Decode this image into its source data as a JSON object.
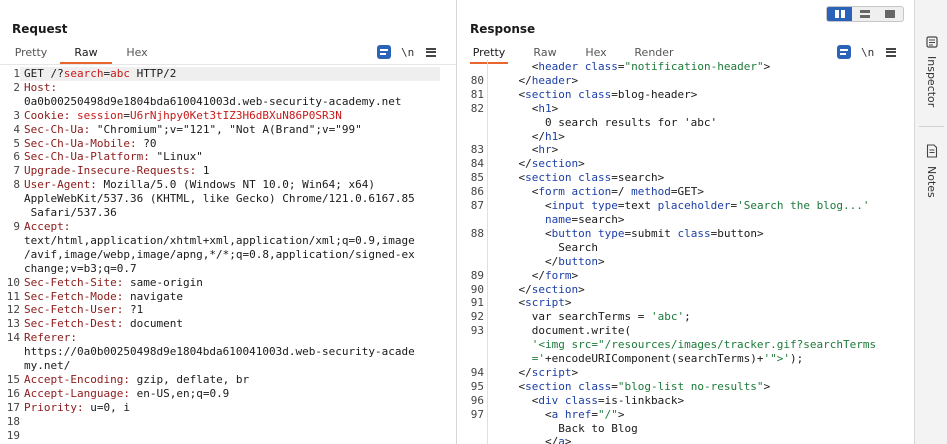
{
  "request": {
    "title": "Request",
    "tabs": [
      "Pretty",
      "Raw",
      "Hex"
    ],
    "active_tab": "Raw",
    "newline_icon_label": "\\n",
    "lines": [
      {
        "n": "1",
        "parts": [
          [
            "c-plain",
            "GET /?"
          ],
          [
            "c-red",
            "search"
          ],
          [
            "c-plain",
            "="
          ],
          [
            "c-red",
            "abc"
          ],
          [
            "c-plain",
            " HTTP/2"
          ]
        ]
      },
      {
        "n": "2",
        "parts": [
          [
            "c-hdr",
            "Host:"
          ]
        ]
      },
      {
        "n": "",
        "parts": [
          [
            "c-plain",
            "0a0b00250498d9e1804bda610041003d.web-security-academy.net"
          ]
        ]
      },
      {
        "n": "3",
        "parts": [
          [
            "c-hdr",
            "Cookie: "
          ],
          [
            "c-red",
            "session"
          ],
          [
            "c-plain",
            "="
          ],
          [
            "c-red",
            "U6rNjhpy0Ket3tIZ3H6dBXuN86P0SR3N"
          ]
        ]
      },
      {
        "n": "4",
        "parts": [
          [
            "c-hdr",
            "Sec-Ch-Ua: "
          ],
          [
            "c-plain",
            "\"Chromium\";v=\"121\", \"Not A(Brand\";v=\"99\""
          ]
        ]
      },
      {
        "n": "5",
        "parts": [
          [
            "c-hdr",
            "Sec-Ch-Ua-Mobile: "
          ],
          [
            "c-plain",
            "?0"
          ]
        ]
      },
      {
        "n": "6",
        "parts": [
          [
            "c-hdr",
            "Sec-Ch-Ua-Platform: "
          ],
          [
            "c-plain",
            "\"Linux\""
          ]
        ]
      },
      {
        "n": "7",
        "parts": [
          [
            "c-hdr",
            "Upgrade-Insecure-Requests: "
          ],
          [
            "c-plain",
            "1"
          ]
        ]
      },
      {
        "n": "8",
        "parts": [
          [
            "c-hdr",
            "User-Agent: "
          ],
          [
            "c-plain",
            "Mozilla/5.0 (Windows NT 10.0; Win64; x64)"
          ]
        ]
      },
      {
        "n": "",
        "parts": [
          [
            "c-plain",
            "AppleWebKit/537.36 (KHTML, like Gecko) Chrome/121.0.6167.85"
          ]
        ]
      },
      {
        "n": "",
        "parts": [
          [
            "c-plain",
            " Safari/537.36"
          ]
        ]
      },
      {
        "n": "9",
        "parts": [
          [
            "c-hdr",
            "Accept:"
          ]
        ]
      },
      {
        "n": "",
        "parts": [
          [
            "c-plain",
            "text/html,application/xhtml+xml,application/xml;q=0.9,image"
          ]
        ]
      },
      {
        "n": "",
        "parts": [
          [
            "c-plain",
            "/avif,image/webp,image/apng,*/*;q=0.8,application/signed-ex"
          ]
        ]
      },
      {
        "n": "",
        "parts": [
          [
            "c-plain",
            "change;v=b3;q=0.7"
          ]
        ]
      },
      {
        "n": "10",
        "parts": [
          [
            "c-hdr",
            "Sec-Fetch-Site: "
          ],
          [
            "c-plain",
            "same-origin"
          ]
        ]
      },
      {
        "n": "11",
        "parts": [
          [
            "c-hdr",
            "Sec-Fetch-Mode: "
          ],
          [
            "c-plain",
            "navigate"
          ]
        ]
      },
      {
        "n": "12",
        "parts": [
          [
            "c-hdr",
            "Sec-Fetch-User: "
          ],
          [
            "c-plain",
            "?1"
          ]
        ]
      },
      {
        "n": "13",
        "parts": [
          [
            "c-hdr",
            "Sec-Fetch-Dest: "
          ],
          [
            "c-plain",
            "document"
          ]
        ]
      },
      {
        "n": "14",
        "parts": [
          [
            "c-hdr",
            "Referer:"
          ]
        ]
      },
      {
        "n": "",
        "parts": [
          [
            "c-plain",
            "https://0a0b00250498d9e1804bda610041003d.web-security-acade"
          ]
        ]
      },
      {
        "n": "",
        "parts": [
          [
            "c-plain",
            "my.net/"
          ]
        ]
      },
      {
        "n": "15",
        "parts": [
          [
            "c-hdr",
            "Accept-Encoding: "
          ],
          [
            "c-plain",
            "gzip, deflate, br"
          ]
        ]
      },
      {
        "n": "16",
        "parts": [
          [
            "c-hdr",
            "Accept-Language: "
          ],
          [
            "c-plain",
            "en-US,en;q=0.9"
          ]
        ]
      },
      {
        "n": "17",
        "parts": [
          [
            "c-hdr",
            "Priority: "
          ],
          [
            "c-plain",
            "u=0, i"
          ]
        ]
      },
      {
        "n": "18",
        "parts": []
      },
      {
        "n": "19",
        "parts": []
      }
    ]
  },
  "response": {
    "title": "Response",
    "tabs": [
      "Pretty",
      "Raw",
      "Hex",
      "Render"
    ],
    "active_tab": "Pretty",
    "newline_icon_label": "\\n",
    "lines": [
      {
        "n": "",
        "parts": [
          [
            "c-plain",
            "      <"
          ],
          [
            "c-tag",
            "header"
          ],
          [
            "c-plain",
            " "
          ],
          [
            "c-attr",
            "class"
          ],
          [
            "c-plain",
            "="
          ],
          [
            "c-str",
            "\"notification-header\""
          ],
          [
            "c-plain",
            ">"
          ]
        ]
      },
      {
        "n": "80",
        "parts": [
          [
            "c-plain",
            "    </"
          ],
          [
            "c-tag",
            "header"
          ],
          [
            "c-plain",
            ">"
          ]
        ]
      },
      {
        "n": "81",
        "parts": [
          [
            "c-plain",
            "    <"
          ],
          [
            "c-tag",
            "section"
          ],
          [
            "c-plain",
            " "
          ],
          [
            "c-attr",
            "class"
          ],
          [
            "c-plain",
            "=blog-header>"
          ]
        ]
      },
      {
        "n": "82",
        "parts": [
          [
            "c-plain",
            "      <"
          ],
          [
            "c-tag",
            "h1"
          ],
          [
            "c-plain",
            ">"
          ]
        ]
      },
      {
        "n": "",
        "parts": [
          [
            "c-plain",
            "        0 search results for 'abc'"
          ]
        ]
      },
      {
        "n": "",
        "parts": [
          [
            "c-plain",
            "      </"
          ],
          [
            "c-tag",
            "h1"
          ],
          [
            "c-plain",
            ">"
          ]
        ]
      },
      {
        "n": "83",
        "parts": [
          [
            "c-plain",
            "      <"
          ],
          [
            "c-tag",
            "hr"
          ],
          [
            "c-plain",
            ">"
          ]
        ]
      },
      {
        "n": "84",
        "parts": [
          [
            "c-plain",
            "    </"
          ],
          [
            "c-tag",
            "section"
          ],
          [
            "c-plain",
            ">"
          ]
        ]
      },
      {
        "n": "85",
        "parts": [
          [
            "c-plain",
            "    <"
          ],
          [
            "c-tag",
            "section"
          ],
          [
            "c-plain",
            " "
          ],
          [
            "c-attr",
            "class"
          ],
          [
            "c-plain",
            "=search>"
          ]
        ]
      },
      {
        "n": "86",
        "parts": [
          [
            "c-plain",
            "      <"
          ],
          [
            "c-tag",
            "form"
          ],
          [
            "c-plain",
            " "
          ],
          [
            "c-attr",
            "action"
          ],
          [
            "c-plain",
            "=/ "
          ],
          [
            "c-attr",
            "method"
          ],
          [
            "c-plain",
            "=GET>"
          ]
        ]
      },
      {
        "n": "87",
        "parts": [
          [
            "c-plain",
            "        <"
          ],
          [
            "c-tag",
            "input"
          ],
          [
            "c-plain",
            " "
          ],
          [
            "c-attr",
            "type"
          ],
          [
            "c-plain",
            "=text "
          ],
          [
            "c-attr",
            "placeholder"
          ],
          [
            "c-plain",
            "="
          ],
          [
            "c-str",
            "'Search the blog...'"
          ]
        ]
      },
      {
        "n": "",
        "parts": [
          [
            "c-plain",
            "        "
          ],
          [
            "c-attr",
            "name"
          ],
          [
            "c-plain",
            "=search>"
          ]
        ]
      },
      {
        "n": "88",
        "parts": [
          [
            "c-plain",
            "        <"
          ],
          [
            "c-tag",
            "button"
          ],
          [
            "c-plain",
            " "
          ],
          [
            "c-attr",
            "type"
          ],
          [
            "c-plain",
            "=submit "
          ],
          [
            "c-attr",
            "class"
          ],
          [
            "c-plain",
            "=button>"
          ]
        ]
      },
      {
        "n": "",
        "parts": [
          [
            "c-plain",
            "          Search"
          ]
        ]
      },
      {
        "n": "",
        "parts": [
          [
            "c-plain",
            "        </"
          ],
          [
            "c-tag",
            "button"
          ],
          [
            "c-plain",
            ">"
          ]
        ]
      },
      {
        "n": "89",
        "parts": [
          [
            "c-plain",
            "      </"
          ],
          [
            "c-tag",
            "form"
          ],
          [
            "c-plain",
            ">"
          ]
        ]
      },
      {
        "n": "90",
        "parts": [
          [
            "c-plain",
            "    </"
          ],
          [
            "c-tag",
            "section"
          ],
          [
            "c-plain",
            ">"
          ]
        ]
      },
      {
        "n": "91",
        "parts": [
          [
            "c-plain",
            "    <"
          ],
          [
            "c-tag",
            "script"
          ],
          [
            "c-plain",
            ">"
          ]
        ]
      },
      {
        "n": "92",
        "parts": [
          [
            "c-plain",
            "      var searchTerms = "
          ],
          [
            "c-str",
            "'abc'"
          ],
          [
            "c-plain",
            ";"
          ]
        ]
      },
      {
        "n": "93",
        "parts": [
          [
            "c-plain",
            "      document.write("
          ]
        ]
      },
      {
        "n": "",
        "parts": [
          [
            "c-plain",
            "      "
          ],
          [
            "c-str",
            "'<img src=\"/resources/images/tracker.gif?searchTerms"
          ]
        ]
      },
      {
        "n": "",
        "parts": [
          [
            "c-str",
            "      ='"
          ],
          [
            "c-plain",
            "+encodeURIComponent(searchTerms)+"
          ],
          [
            "c-str",
            "'\">'"
          ],
          [
            "c-plain",
            ");"
          ]
        ]
      },
      {
        "n": "94",
        "parts": [
          [
            "c-plain",
            "    </"
          ],
          [
            "c-tag",
            "script"
          ],
          [
            "c-plain",
            ">"
          ]
        ]
      },
      {
        "n": "95",
        "parts": [
          [
            "c-plain",
            "    <"
          ],
          [
            "c-tag",
            "section"
          ],
          [
            "c-plain",
            " "
          ],
          [
            "c-attr",
            "class"
          ],
          [
            "c-plain",
            "="
          ],
          [
            "c-str",
            "\"blog-list no-results\""
          ],
          [
            "c-plain",
            ">"
          ]
        ]
      },
      {
        "n": "96",
        "parts": [
          [
            "c-plain",
            "      <"
          ],
          [
            "c-tag",
            "div"
          ],
          [
            "c-plain",
            " "
          ],
          [
            "c-attr",
            "class"
          ],
          [
            "c-plain",
            "=is-linkback>"
          ]
        ]
      },
      {
        "n": "97",
        "parts": [
          [
            "c-plain",
            "        <"
          ],
          [
            "c-tag",
            "a"
          ],
          [
            "c-plain",
            " "
          ],
          [
            "c-attr",
            "href"
          ],
          [
            "c-plain",
            "="
          ],
          [
            "c-str",
            "\"/\""
          ],
          [
            "c-plain",
            ">"
          ]
        ]
      },
      {
        "n": "",
        "parts": [
          [
            "c-plain",
            "          Back to Blog"
          ]
        ]
      },
      {
        "n": "",
        "parts": [
          [
            "c-plain",
            "        </"
          ],
          [
            "c-tag",
            "a"
          ],
          [
            "c-plain",
            ">"
          ]
        ]
      }
    ]
  },
  "side_panel": {
    "inspector_label": "Inspector",
    "notes_label": "Notes"
  },
  "colors": {
    "accent_tab_underline": "#e8662e",
    "toggle_active": "#2a63b8",
    "header_name": "#8b1a1a",
    "param_red": "#c81919",
    "tag_blue": "#1d3fa6",
    "string_green": "#1c7a3a"
  }
}
